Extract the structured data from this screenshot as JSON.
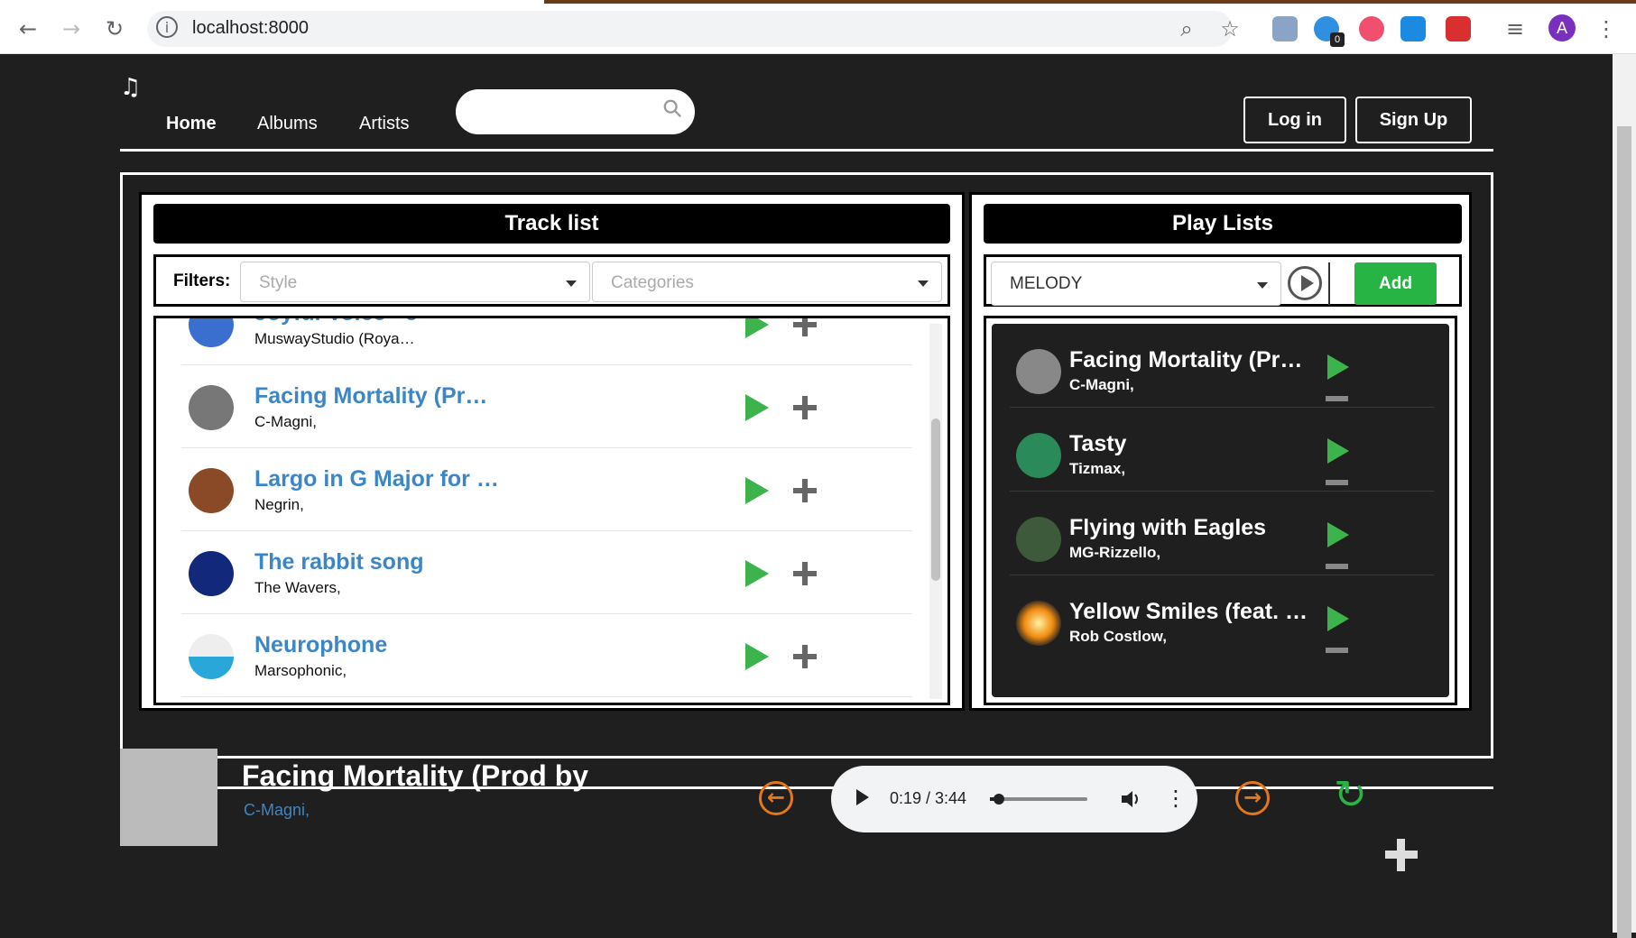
{
  "browser": {
    "url": "localhost:8000",
    "extension_badge": "0",
    "profile_initial": "A"
  },
  "nav": {
    "links": [
      "Home",
      "Albums",
      "Artists"
    ],
    "login": "Log in",
    "signup": "Sign Up"
  },
  "tracklist": {
    "title": "Track list",
    "filters_label": "Filters:",
    "style_placeholder": "Style",
    "categories_placeholder": "Categories",
    "tracks": [
      {
        "title": "Joyful Voice - J",
        "artist": "MuswayStudio (Roya…"
      },
      {
        "title": "Facing Mortality (Pr…",
        "artist": "C-Magni,"
      },
      {
        "title": "Largo in G Major for …",
        "artist": "Negrin,"
      },
      {
        "title": "The rabbit song",
        "artist": "The Wavers,"
      },
      {
        "title": "Neurophone",
        "artist": "Marsophonic,"
      }
    ]
  },
  "playlists": {
    "title": "Play Lists",
    "selected": "MELODY",
    "add_label": "Add",
    "items": [
      {
        "title": "Facing Mortality (Pr…",
        "artist": "C-Magni,"
      },
      {
        "title": "Tasty",
        "artist": "Tizmax,"
      },
      {
        "title": "Flying with Eagles",
        "artist": "MG-Rizzello,"
      },
      {
        "title": "Yellow Smiles (feat. …",
        "artist": "Rob Costlow,"
      }
    ]
  },
  "now_playing": {
    "title": "Facing Mortality (Prod by",
    "artist": "C-Magni,",
    "time": "0:19 / 3:44",
    "progress": 0.09
  },
  "colors": {
    "accent_green": "#28b445",
    "link_blue": "#3b86c6",
    "arrow_orange": "#e3771e"
  }
}
